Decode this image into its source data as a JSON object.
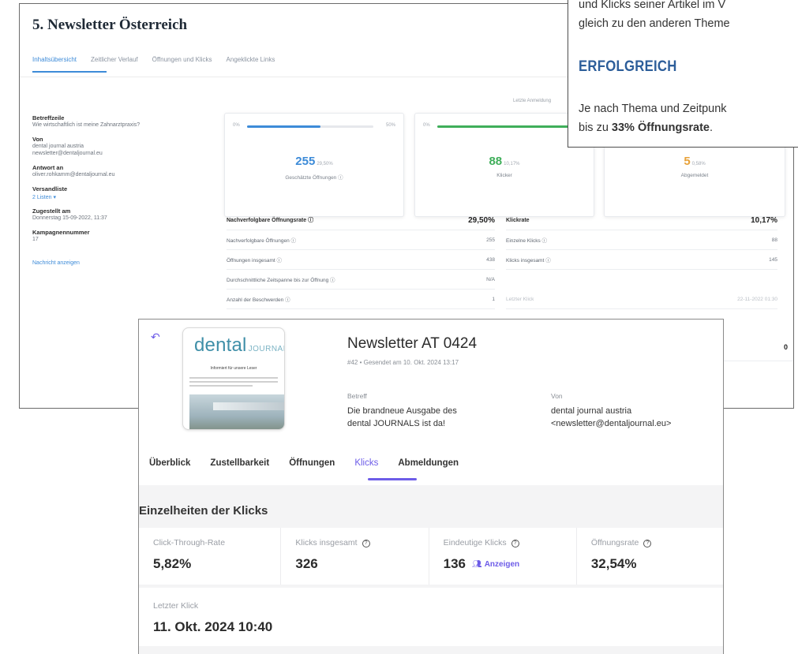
{
  "back_window": {
    "title": "5. Newsletter Österreich",
    "tabs": [
      "Inhaltsübersicht",
      "Zeitlicher Verlauf",
      "Öffnungen und Klicks",
      "Angeklickte Links"
    ],
    "last_update": "Letzte Anmeldung",
    "meta": {
      "subject_label": "Betreffzeile",
      "subject_value": "Wie wirtschaftlich ist meine Zahnarztpraxis?",
      "from_label": "Von",
      "from_name": "dental journal austria",
      "from_email": "newsletter@dentaljournal.eu",
      "reply_label": "Antwort an",
      "reply_value": "oliver.rohkamm@dentaljournal.eu",
      "list_label": "Versandliste",
      "list_value": "2 Listen ▾",
      "sent_label": "Zugestellt am",
      "sent_value": "Donnerstag 15-09-2022, 11:37",
      "campaign_label": "Kampagnennummer",
      "campaign_value": "17",
      "show_message": "Nachricht anzeigen"
    },
    "cards": [
      {
        "left": "0%",
        "right": "50%",
        "number": "255",
        "percent": "29,50%",
        "caption": "Geschätzte Öffnungen ⓘ",
        "fill": 0.58,
        "color": "#3d8bd8"
      },
      {
        "left": "0%",
        "right": "",
        "number": "88",
        "percent": "10,17%",
        "caption": "Klicker",
        "fill": 0.95,
        "color": "#3fae5a"
      },
      {
        "left": "",
        "right": "",
        "number": "5",
        "percent": "0,58%",
        "caption": "Abgemeldet",
        "fill": 0,
        "color": "#e8a23a"
      }
    ],
    "table_left": [
      {
        "label": "Nachverfolgbare Öffnungsrate ⓘ",
        "value": "29,50%"
      },
      {
        "label": "Nachverfolgbare Öffnungen ⓘ",
        "value": "255"
      },
      {
        "label": "Öffnungen insgesamt ⓘ",
        "value": "438"
      },
      {
        "label": "Durchschnittliche Zeitspanne bis zur Öffnung ⓘ",
        "value": "N/A"
      },
      {
        "label": "Anzahl der Beschwerden ⓘ",
        "value": "1"
      }
    ],
    "table_right": [
      {
        "label": "Klickrate",
        "value": "10,17%"
      },
      {
        "label": "Einzelne Klicks ⓘ",
        "value": "88"
      },
      {
        "label": "Klicks insgesamt ⓘ",
        "value": "145"
      },
      {
        "label": "",
        "value": ""
      },
      {
        "label": "Letzter Klick",
        "value": "22-11-2022 01:30"
      }
    ],
    "zero_value": "0"
  },
  "callout": {
    "line1": "und Klicks seiner Artikel im V",
    "line2": "gleich zu den anderen Theme",
    "heading": "ERFOLGREICH",
    "line3": "Je nach Thema und Zeitpunk",
    "line4_pre": "bis zu ",
    "line4_bold": "33% Öffnungsrate",
    "line4_post": "."
  },
  "front_window": {
    "back_icon": "back-arrow-icon",
    "thumb": {
      "logo_main": "dental",
      "logo_sub": "JOURNAL",
      "tagline": "Informiert für unsere Leser"
    },
    "title": "Newsletter AT 0424",
    "subtitle": "#42 • Gesendet am 10. Okt. 2024 13:17",
    "subject_label": "Betreff",
    "subject_line1": "Die brandneue Ausgabe des",
    "subject_line2": "dental JOURNALS ist da!",
    "from_label": "Von",
    "from_line1": "dental journal austria",
    "from_line2": "<newsletter@dentaljournal.eu>",
    "tabs": [
      "Überblick",
      "Zustellbarkeit",
      "Öffnungen",
      "Klicks",
      "Abmeldungen"
    ],
    "active_tab": "Klicks",
    "section_title": "Einzelheiten der Klicks",
    "metrics": [
      {
        "label": "Click-Through-Rate",
        "value": "5,82%",
        "info": false
      },
      {
        "label": "Klicks insgesamt",
        "value": "326",
        "info": true
      },
      {
        "label": "Eindeutige Klicks",
        "value": "136",
        "info": true,
        "action": "Anzeigen"
      },
      {
        "label": "Öffnungsrate",
        "value": "32,54%",
        "info": true
      }
    ],
    "last_click_label": "Letzter Klick",
    "last_click_value": "11. Okt. 2024 10:40"
  }
}
